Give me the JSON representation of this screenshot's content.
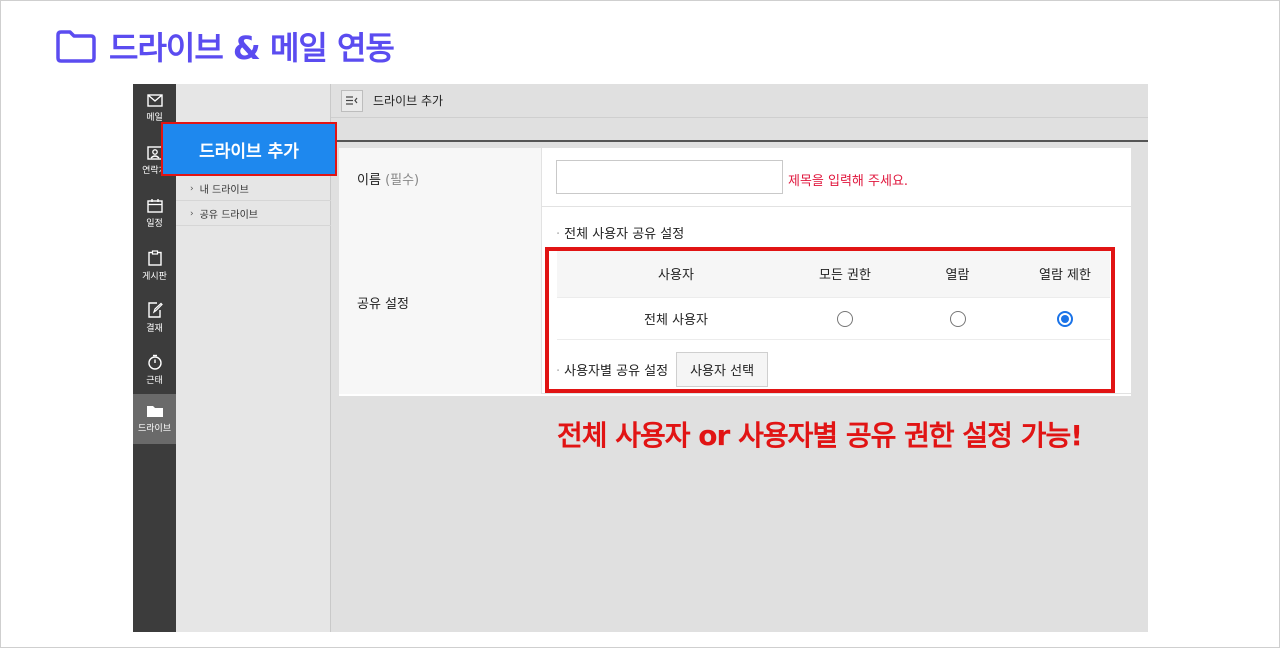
{
  "heading": {
    "title": "드라이브 & 메일 연동",
    "icon": "folder-icon",
    "color": "#5b4cf0"
  },
  "rail": {
    "items": [
      {
        "label": "메일",
        "icon": "mail-icon"
      },
      {
        "label": "연락처",
        "icon": "contact-icon"
      },
      {
        "label": "일정",
        "icon": "calendar-icon"
      },
      {
        "label": "게시판",
        "icon": "board-icon"
      },
      {
        "label": "결재",
        "icon": "approval-icon"
      },
      {
        "label": "근태",
        "icon": "attendance-icon"
      },
      {
        "label": "드라이브",
        "icon": "drive-folder-icon",
        "active": true
      }
    ]
  },
  "sidebar": {
    "popup_button": "드라이브 추가",
    "tree": [
      {
        "label": "내 드라이브"
      },
      {
        "label": "공유 드라이브"
      }
    ]
  },
  "topbar": {
    "breadcrumb": "드라이브 추가"
  },
  "form": {
    "name_label": "이름",
    "name_required": "(필수)",
    "name_value": "",
    "name_hint": "제목을 입력해 주세요.",
    "share_label": "공유 설정",
    "all_users_title": "전체 사용자 공유 설정",
    "table": {
      "headers": [
        "사용자",
        "모든 권한",
        "열람",
        "열람 제한"
      ],
      "row_label": "전체 사용자",
      "selected": "열람 제한"
    },
    "per_user_label": "사용자별 공유 설정",
    "select_user_button": "사용자 선택"
  },
  "annotation": "전체 사용자 or 사용자별 공유 권한 설정 가능!",
  "accent_colors": {
    "highlight": "#e11414",
    "primary": "#1e88ee"
  }
}
